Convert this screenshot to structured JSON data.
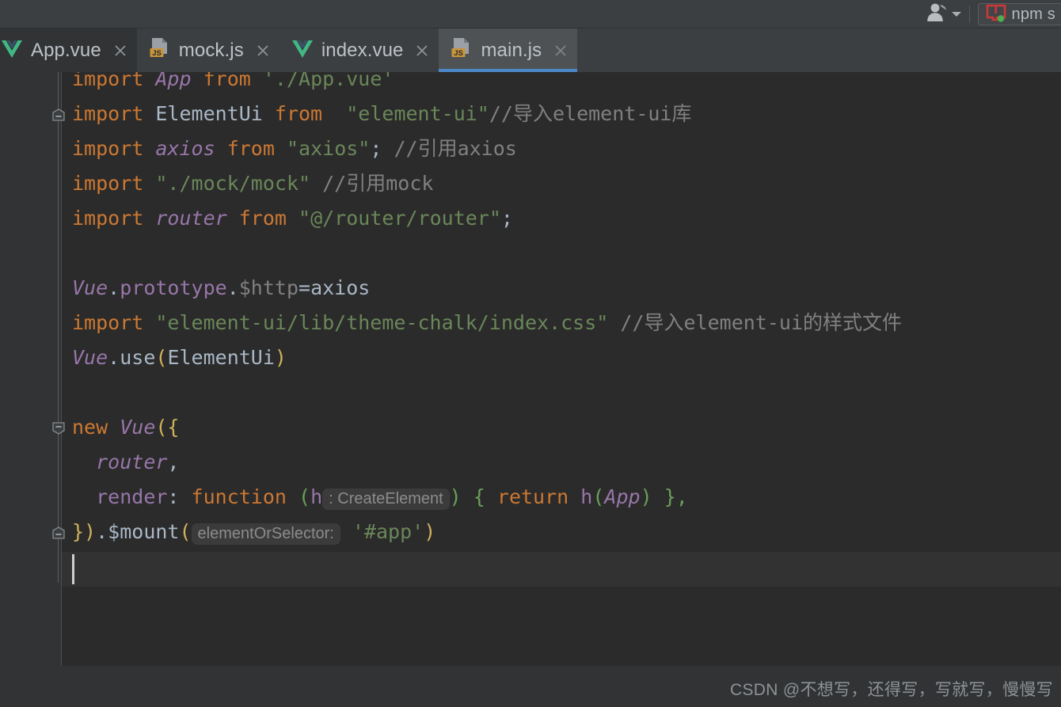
{
  "toolbar": {
    "avatar_icon": "user-avatar-icon",
    "avatar_dropdown_icon": "chevron-down-icon",
    "run_config": {
      "icon": "npm-run-icon",
      "label": "npm s"
    }
  },
  "tabs": [
    {
      "label": "App.vue",
      "icon": "vue-file-icon",
      "active": false,
      "close_icon": "close-icon"
    },
    {
      "label": "mock.js",
      "icon": "javascript-file-icon",
      "active": false,
      "close_icon": "close-icon"
    },
    {
      "label": "index.vue",
      "icon": "vue-file-icon",
      "active": false,
      "close_icon": "close-icon"
    },
    {
      "label": "main.js",
      "icon": "javascript-file-icon",
      "active": true,
      "close_icon": "close-icon"
    }
  ],
  "editor": {
    "active_file": "main.js",
    "caret_line_index": 14,
    "fold_markers": [
      {
        "line": 1,
        "type": "fold-start-up-icon"
      },
      {
        "line": 10,
        "type": "fold-collapse-down-icon"
      },
      {
        "line": 13,
        "type": "fold-end-up-icon"
      }
    ],
    "lines": [
      {
        "n": 0,
        "tokens": [
          {
            "t": "import",
            "c": "kw"
          },
          {
            "t": " ",
            "c": "plain"
          },
          {
            "t": "App",
            "c": "ident"
          },
          {
            "t": " ",
            "c": "plain"
          },
          {
            "t": "from",
            "c": "kw"
          },
          {
            "t": " ",
            "c": "plain"
          },
          {
            "t": "'./App.vue'",
            "c": "str"
          }
        ]
      },
      {
        "n": 1,
        "tokens": [
          {
            "t": "import",
            "c": "kw"
          },
          {
            "t": " ",
            "c": "plain"
          },
          {
            "t": "ElementUi",
            "c": "plain"
          },
          {
            "t": " ",
            "c": "plain"
          },
          {
            "t": "from",
            "c": "kw"
          },
          {
            "t": "  ",
            "c": "plain"
          },
          {
            "t": "\"element-ui\"",
            "c": "str"
          },
          {
            "t": "//导入element-ui库",
            "c": "cmt"
          }
        ]
      },
      {
        "n": 2,
        "tokens": [
          {
            "t": "import",
            "c": "kw"
          },
          {
            "t": " ",
            "c": "plain"
          },
          {
            "t": "axios",
            "c": "ident"
          },
          {
            "t": " ",
            "c": "plain"
          },
          {
            "t": "from",
            "c": "kw"
          },
          {
            "t": " ",
            "c": "plain"
          },
          {
            "t": "\"axios\"",
            "c": "str"
          },
          {
            "t": ";",
            "c": "plain"
          },
          {
            "t": " ",
            "c": "plain"
          },
          {
            "t": "//引用axios",
            "c": "cmt"
          }
        ]
      },
      {
        "n": 3,
        "tokens": [
          {
            "t": "import",
            "c": "kw"
          },
          {
            "t": " ",
            "c": "plain"
          },
          {
            "t": "\"./mock/mock\"",
            "c": "str"
          },
          {
            "t": " ",
            "c": "plain"
          },
          {
            "t": "//引用mock",
            "c": "cmt"
          }
        ]
      },
      {
        "n": 4,
        "tokens": [
          {
            "t": "import",
            "c": "kw"
          },
          {
            "t": " ",
            "c": "plain"
          },
          {
            "t": "router",
            "c": "ident"
          },
          {
            "t": " ",
            "c": "plain"
          },
          {
            "t": "from",
            "c": "kw"
          },
          {
            "t": " ",
            "c": "plain"
          },
          {
            "t": "\"@/router/router\"",
            "c": "str"
          },
          {
            "t": ";",
            "c": "plain"
          }
        ]
      },
      {
        "n": 5,
        "tokens": []
      },
      {
        "n": 6,
        "tokens": [
          {
            "t": "Vue",
            "c": "ident"
          },
          {
            "t": ".",
            "c": "plain"
          },
          {
            "t": "prototype",
            "c": "ident-ni"
          },
          {
            "t": ".",
            "c": "plain"
          },
          {
            "t": "$http",
            "c": "grey"
          },
          {
            "t": "=",
            "c": "plain"
          },
          {
            "t": "axios",
            "c": "plain"
          }
        ]
      },
      {
        "n": 7,
        "tokens": [
          {
            "t": "import",
            "c": "kw"
          },
          {
            "t": " ",
            "c": "plain"
          },
          {
            "t": "\"element-ui/lib/theme-chalk/index.css\"",
            "c": "str"
          },
          {
            "t": " ",
            "c": "plain"
          },
          {
            "t": "//导入element-ui的样式文件",
            "c": "cmt"
          }
        ]
      },
      {
        "n": 8,
        "tokens": [
          {
            "t": "Vue",
            "c": "ident"
          },
          {
            "t": ".",
            "c": "plain"
          },
          {
            "t": "use",
            "c": "plain"
          },
          {
            "t": "(",
            "c": "brace"
          },
          {
            "t": "ElementUi",
            "c": "plain"
          },
          {
            "t": ")",
            "c": "brace"
          }
        ]
      },
      {
        "n": 9,
        "tokens": []
      },
      {
        "n": 10,
        "tokens": [
          {
            "t": "new",
            "c": "kw"
          },
          {
            "t": " ",
            "c": "plain"
          },
          {
            "t": "Vue",
            "c": "ident"
          },
          {
            "t": "({",
            "c": "brace"
          }
        ]
      },
      {
        "n": 11,
        "tokens": [
          {
            "t": "  ",
            "c": "plain"
          },
          {
            "t": "router",
            "c": "ident"
          },
          {
            "t": ",",
            "c": "plain"
          }
        ]
      },
      {
        "n": 12,
        "tokens": [
          {
            "t": "  ",
            "c": "plain"
          },
          {
            "t": "render",
            "c": "field"
          },
          {
            "t": ": ",
            "c": "plain"
          },
          {
            "t": "function",
            "c": "kw"
          },
          {
            "t": " ",
            "c": "plain"
          },
          {
            "t": "(",
            "c": "paren-g"
          },
          {
            "t": "h",
            "c": "ident-ni"
          },
          {
            "t": ": CreateElement",
            "c": "hint"
          },
          {
            "t": ")",
            "c": "paren-g"
          },
          {
            "t": " ",
            "c": "plain"
          },
          {
            "t": "{",
            "c": "paren-g"
          },
          {
            "t": " ",
            "c": "plain"
          },
          {
            "t": "return",
            "c": "kw"
          },
          {
            "t": " ",
            "c": "plain"
          },
          {
            "t": "h",
            "c": "ident-ni"
          },
          {
            "t": "(",
            "c": "paren-g"
          },
          {
            "t": "App",
            "c": "ident"
          },
          {
            "t": ")",
            "c": "paren-g"
          },
          {
            "t": " ",
            "c": "plain"
          },
          {
            "t": "}",
            "c": "paren-g"
          },
          {
            "t": ",",
            "c": "paren-g"
          }
        ]
      },
      {
        "n": 13,
        "tokens": [
          {
            "t": "})",
            "c": "brace"
          },
          {
            "t": ".",
            "c": "plain"
          },
          {
            "t": "$mount",
            "c": "plain"
          },
          {
            "t": "(",
            "c": "brace"
          },
          {
            "t": "elementOrSelector:",
            "c": "hint"
          },
          {
            "t": " ",
            "c": "plain"
          },
          {
            "t": "'#app'",
            "c": "str"
          },
          {
            "t": ")",
            "c": "brace"
          }
        ]
      },
      {
        "n": 14,
        "tokens": []
      }
    ]
  },
  "watermark": {
    "text": "CSDN @不想写，还得写，写就写，慢慢写"
  },
  "colors": {
    "editor_bg": "#2b2b2b",
    "gutter_bg": "#313335",
    "chrome_bg": "#3c3f41",
    "active_tab_bg": "#4e5254",
    "active_tab_underline": "#4a88c7",
    "keyword": "#cc7832",
    "identifier": "#9876aa",
    "string": "#6a8759",
    "comment": "#808080",
    "brace": "#d0b25a",
    "paren_green": "#6a9f5b",
    "default_text": "#a9b7c6",
    "js_badge": "#c9953d",
    "vue_green": "#41b883",
    "npm_red": "#cb3837",
    "run_dot_green": "#4caf50"
  }
}
